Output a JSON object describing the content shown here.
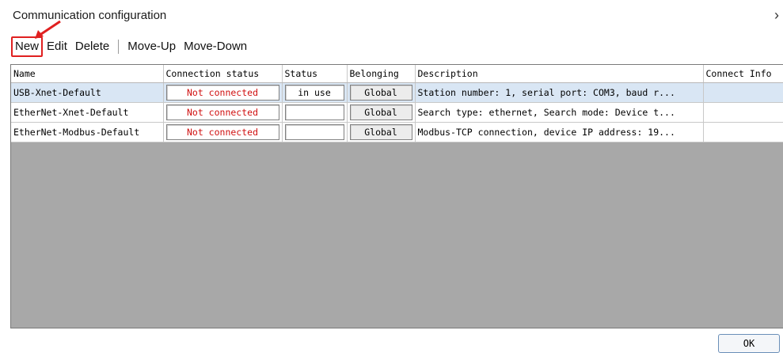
{
  "window": {
    "title": "Communication configuration",
    "close_glyph": "›"
  },
  "toolbar": {
    "new_label": "New",
    "edit_label": "Edit",
    "delete_label": "Delete",
    "move_up_label": "Move-Up",
    "move_down_label": "Move-Down"
  },
  "table": {
    "columns": [
      "Name",
      "Connection status",
      "Status",
      "Belonging",
      "Description",
      "Connect Info"
    ],
    "rows": [
      {
        "name": "USB-Xnet-Default",
        "connection_status": "Not connected",
        "status": "in use",
        "belonging": "Global",
        "description": "Station number: 1, serial port: COM3, baud r...",
        "connect_info": ""
      },
      {
        "name": "EtherNet-Xnet-Default",
        "connection_status": "Not connected",
        "status": "",
        "belonging": "Global",
        "description": "Search type: ethernet, Search mode: Device t...",
        "connect_info": ""
      },
      {
        "name": "EtherNet-Modbus-Default",
        "connection_status": "Not connected",
        "status": "",
        "belonging": "Global",
        "description": "Modbus-TCP connection, device IP address: 19...",
        "connect_info": ""
      }
    ]
  },
  "footer": {
    "ok_label": "OK"
  },
  "colors": {
    "highlight": "#e02020",
    "not_connected": "#d01010",
    "selected_row": "#d9e6f4"
  }
}
